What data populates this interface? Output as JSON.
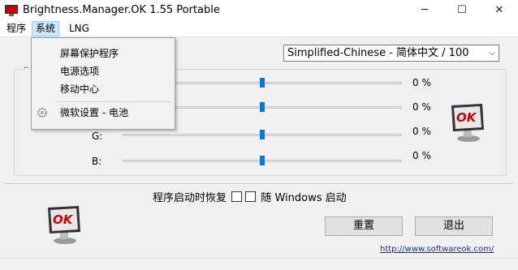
{
  "window": {
    "title": "Brightness.Manager.OK 1.55 Portable",
    "minimize_glyph": "─",
    "maximize_glyph": "☐",
    "close_glyph": "✕"
  },
  "menubar": {
    "items": [
      "程序",
      "系统",
      "LNG"
    ],
    "active_index": 1
  },
  "dropdown": {
    "items": [
      "屏幕保护程序",
      "电源选项",
      "移动中心",
      "微软设置 - 电池"
    ]
  },
  "language_select": {
    "value": "Simplified-Chinese - 简体中文 / 100",
    "arrow": "⌵"
  },
  "groupbox_label": "··",
  "channels": [
    {
      "label": "",
      "percent_text": "0 %",
      "level": 0.5
    },
    {
      "label": "",
      "percent_text": "0 %",
      "level": 0.5
    },
    {
      "label": "G:",
      "percent_text": "0 %",
      "level": 0.5
    },
    {
      "label": "B:",
      "percent_text": "0 %",
      "level": 0.5
    }
  ],
  "restore": {
    "prefix": "程序启动时恢复",
    "with_text": "随",
    "suffix": "Windows 启动"
  },
  "buttons": {
    "reset": "重置",
    "exit": "退出"
  },
  "link": "http://www.softwareok.com/",
  "logo_text": "OK",
  "colors": {
    "accent": "#0078d7",
    "menu_highlight": "#cce8ff",
    "logo_red": "#d40000"
  }
}
